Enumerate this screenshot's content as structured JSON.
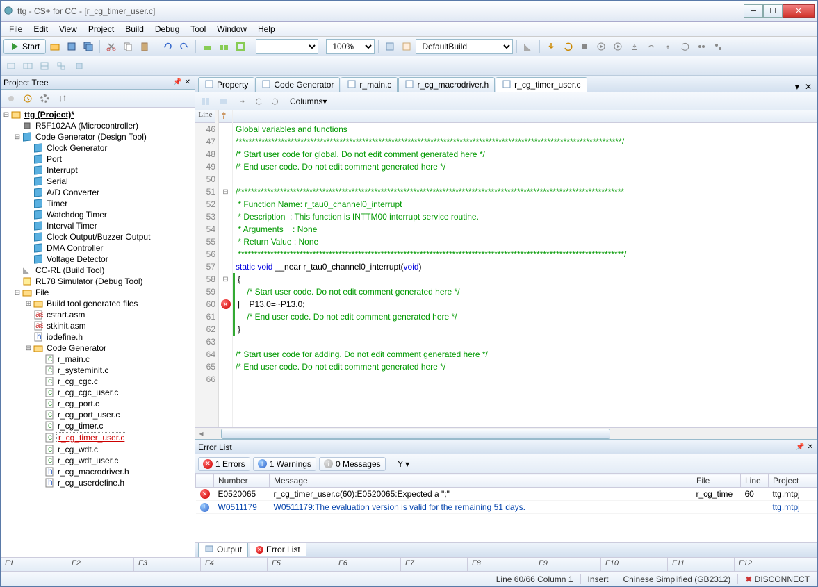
{
  "window": {
    "title": "ttg - CS+ for CC - [r_cg_timer_user.c]"
  },
  "menu": [
    "File",
    "Edit",
    "View",
    "Project",
    "Build",
    "Debug",
    "Tool",
    "Window",
    "Help"
  ],
  "toolbar": {
    "start_label": "Start",
    "zoom": "100%",
    "build_config": "DefaultBuild"
  },
  "editor_toolbar": {
    "columns_label": "Columns"
  },
  "project_tree": {
    "title": "Project Tree",
    "root": "ttg (Project)*",
    "mcu": "R5F102AA (Microcontroller)",
    "codegen": "Code Generator (Design Tool)",
    "cg_items": [
      "Clock Generator",
      "Port",
      "Interrupt",
      "Serial",
      "A/D Converter",
      "Timer",
      "Watchdog Timer",
      "Interval Timer",
      "Clock Output/Buzzer Output",
      "DMA Controller",
      "Voltage Detector"
    ],
    "build_tool": "CC-RL (Build Tool)",
    "debug_tool": "RL78 Simulator (Debug Tool)",
    "file_root": "File",
    "build_files": "Build tool generated files",
    "asm_files": [
      "cstart.asm",
      "stkinit.asm"
    ],
    "hfile": "iodefine.h",
    "codegen_folder": "Code Generator",
    "c_files": [
      "r_main.c",
      "r_systeminit.c",
      "r_cg_cgc.c",
      "r_cg_cgc_user.c",
      "r_cg_port.c",
      "r_cg_port_user.c",
      "r_cg_timer.c",
      "r_cg_timer_user.c",
      "r_cg_wdt.c",
      "r_cg_wdt_user.c",
      "r_cg_macrodriver.h",
      "r_cg_userdefine.h"
    ],
    "selected_file": "r_cg_timer_user.c"
  },
  "doc_tabs": [
    {
      "label": "Property",
      "icon": "prop"
    },
    {
      "label": "Code Generator",
      "icon": "cg"
    },
    {
      "label": "r_main.c",
      "icon": "c"
    },
    {
      "label": "r_cg_macrodriver.h",
      "icon": "h"
    },
    {
      "label": "r_cg_timer_user.c",
      "icon": "c",
      "active": true
    }
  ],
  "code": {
    "start": 46,
    "lines": [
      {
        "t": "Global variables and functions",
        "cls": "c-comment"
      },
      {
        "t": "***********************************************************************************************************************/",
        "cls": "c-comment"
      },
      {
        "t": "/* Start user code for global. Do not edit comment generated here */",
        "cls": "c-comment"
      },
      {
        "t": "/* End user code. Do not edit comment generated here */",
        "cls": "c-comment"
      },
      {
        "t": "",
        "cls": "c-txt"
      },
      {
        "t": "/***********************************************************************************************************************",
        "cls": "c-comment",
        "fold": "-"
      },
      {
        "t": " * Function Name: r_tau0_channel0_interrupt",
        "cls": "c-comment"
      },
      {
        "t": " * Description  : This function is INTTM00 interrupt service routine.",
        "cls": "c-comment"
      },
      {
        "t": " * Arguments    : None",
        "cls": "c-comment"
      },
      {
        "t": " * Return Value : None",
        "cls": "c-comment"
      },
      {
        "t": " ***********************************************************************************************************************/",
        "cls": "c-comment"
      },
      {
        "html": "<span class='c-kw'>static</span> <span class='c-kw'>void</span> __near r_tau0_channel0_interrupt(<span class='c-kw'>void</span>)",
        "cls": "c-txt"
      },
      {
        "t": "{",
        "cls": "c-txt",
        "fold": "-",
        "green": true
      },
      {
        "t": "    /* Start user code. Do not edit comment generated here */",
        "cls": "c-comment",
        "green": true
      },
      {
        "t": "|    P13.0=~P13.0;",
        "cls": "c-txt",
        "mark": "err",
        "green": true
      },
      {
        "t": "    /* End user code. Do not edit comment generated here */",
        "cls": "c-comment",
        "green": true
      },
      {
        "t": "}",
        "cls": "c-txt",
        "green": true
      },
      {
        "t": "",
        "cls": "c-txt"
      },
      {
        "t": "/* Start user code for adding. Do not edit comment generated here */",
        "cls": "c-comment"
      },
      {
        "t": "/* End user code. Do not edit comment generated here */",
        "cls": "c-comment"
      },
      {
        "t": "",
        "cls": "c-txt"
      }
    ]
  },
  "error_list": {
    "title": "Error List",
    "filters": {
      "errors": "1 Errors",
      "warnings": "1 Warnings",
      "messages": "0 Messages"
    },
    "cols": [
      "",
      "Number",
      "Message",
      "File",
      "Line",
      "Project"
    ],
    "rows": [
      {
        "icon": "err",
        "num": "E0520065",
        "msg": "r_cg_timer_user.c(60):E0520065:Expected a \";\"",
        "file": "r_cg_time",
        "line": "60",
        "project": "ttg.mtpj"
      },
      {
        "icon": "warn",
        "num": "W0511179",
        "msg": "W0511179:The evaluation version is valid for the remaining 51 days.",
        "file": "",
        "line": "",
        "project": "ttg.mtpj",
        "link": true
      }
    ]
  },
  "bottom_tabs": [
    "Output",
    "Error List"
  ],
  "fkeys": [
    "F1",
    "F2",
    "F3",
    "F4",
    "F5",
    "F6",
    "F7",
    "F8",
    "F9",
    "F10",
    "F11",
    "F12"
  ],
  "status": {
    "line_col": "Line 60/66   Column 1",
    "insert": "Insert",
    "encoding": "Chinese Simplified (GB2312)",
    "connect": "DISCONNECT"
  },
  "gutter_header": "Line"
}
